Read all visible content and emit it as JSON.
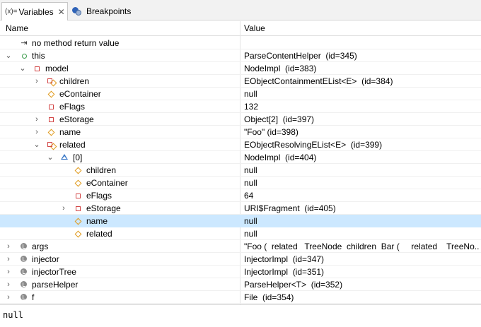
{
  "tabs": [
    {
      "icon_text": "(x)=",
      "label": "Variables",
      "close": "✕"
    },
    {
      "label": "Breakpoints"
    }
  ],
  "header": {
    "name": "Name",
    "value": "Value"
  },
  "rows": [
    {
      "name": "no method return value",
      "value": "",
      "icon": "return-icon",
      "twisty": ""
    },
    {
      "name": "this",
      "value": "ParseContentHelper  (id=345)",
      "icon": "field-public-icon",
      "twisty": "v"
    },
    {
      "name": "model",
      "value": "NodeImpl  (id=383)",
      "icon": "field-private-icon",
      "twisty": "v"
    },
    {
      "name": "children",
      "value": "EObjectContainmentEList<E>  (id=384)",
      "icon": "field-collection-icon",
      "twisty": ">"
    },
    {
      "name": "eContainer",
      "value": "null",
      "icon": "field-protected-icon",
      "twisty": ""
    },
    {
      "name": "eFlags",
      "value": "132",
      "icon": "field-private-icon",
      "twisty": ""
    },
    {
      "name": "eStorage",
      "value": "Object[2]  (id=397)",
      "icon": "field-private-icon",
      "twisty": ">"
    },
    {
      "name": "name",
      "value": "\"Foo\" (id=398)",
      "icon": "field-protected-icon",
      "twisty": ">"
    },
    {
      "name": "related",
      "value": "EObjectResolvingEList<E>  (id=399)",
      "icon": "field-collection-icon",
      "twisty": "v"
    },
    {
      "name": "[0]",
      "value": "NodeImpl  (id=404)",
      "icon": "array-element-icon",
      "twisty": "v"
    },
    {
      "name": "children",
      "value": "null",
      "icon": "field-protected-icon",
      "twisty": ""
    },
    {
      "name": "eContainer",
      "value": "null",
      "icon": "field-protected-icon",
      "twisty": ""
    },
    {
      "name": "eFlags",
      "value": "64",
      "icon": "field-private-icon",
      "twisty": ""
    },
    {
      "name": "eStorage",
      "value": "URI$Fragment  (id=405)",
      "icon": "field-private-icon",
      "twisty": ">"
    },
    {
      "name": "name",
      "value": "null",
      "icon": "field-protected-icon",
      "twisty": ""
    },
    {
      "name": "related",
      "value": "null",
      "icon": "field-protected-icon",
      "twisty": ""
    },
    {
      "name": "args",
      "value": "\"Foo (  related   TreeNode  children  Bar (     related    TreeNo...",
      "icon": "local-variable-icon",
      "twisty": ">"
    },
    {
      "name": "injector",
      "value": "InjectorImpl  (id=347)",
      "icon": "local-variable-icon",
      "twisty": ">"
    },
    {
      "name": "injectorTree",
      "value": "InjectorImpl  (id=351)",
      "icon": "local-variable-icon",
      "twisty": ">"
    },
    {
      "name": "parseHelper",
      "value": "ParseHelper<T>  (id=352)",
      "icon": "local-variable-icon",
      "twisty": ">"
    },
    {
      "name": "f",
      "value": "File  (id=354)",
      "icon": "local-variable-icon",
      "twisty": ">"
    }
  ],
  "detail": {
    "text": "null"
  },
  "colors": {
    "selection": "#cce8ff",
    "tabbar": "#f2f2f2"
  }
}
